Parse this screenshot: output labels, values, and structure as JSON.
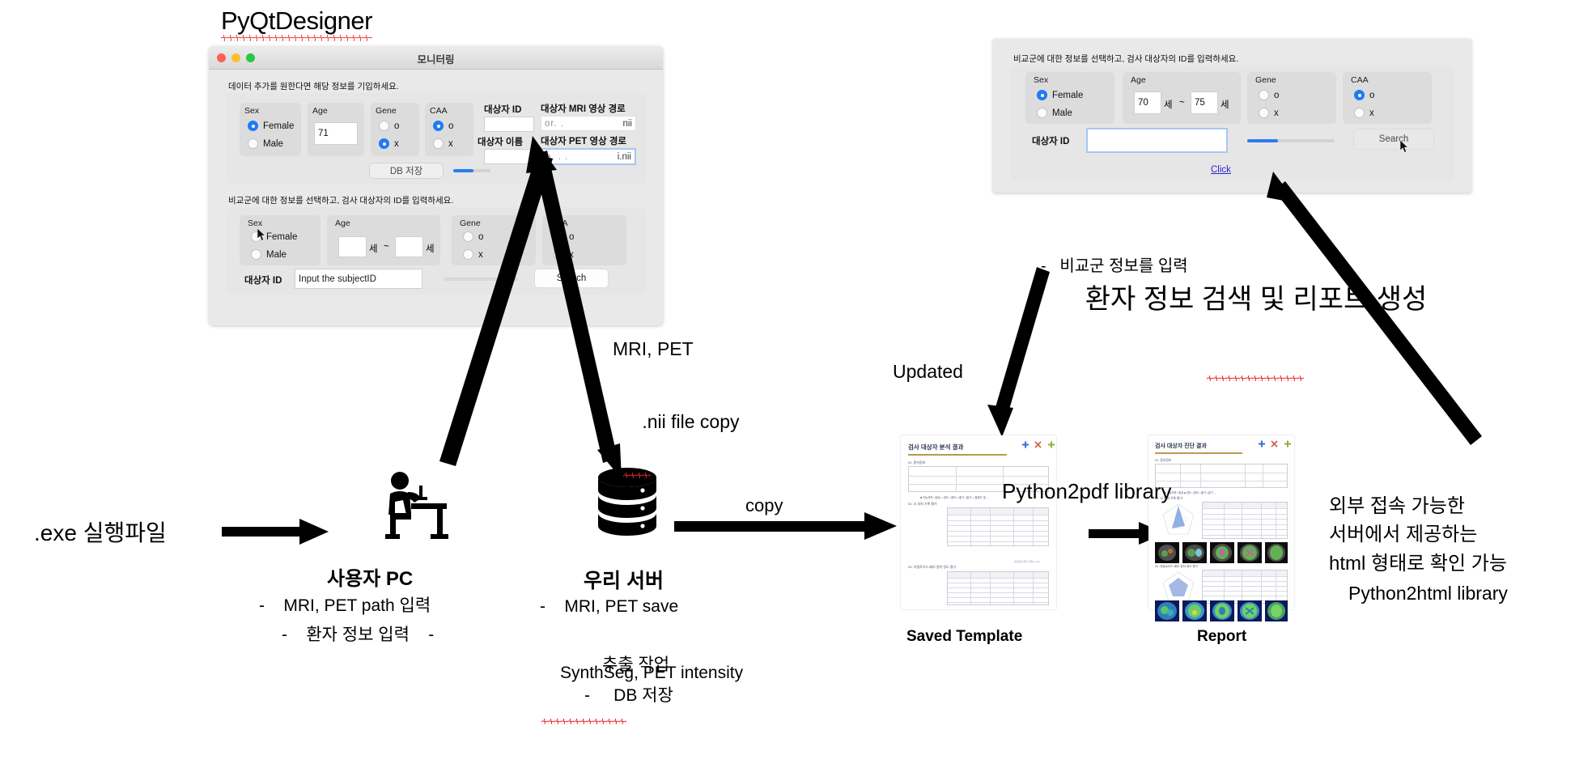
{
  "headings": {
    "pyqt_designer": "PyQtDesigner",
    "right_title": "환자 정보 검색 및 리포트 생성",
    "right_bullet": "-   비교군 정보를 입력"
  },
  "window_monitoring": {
    "title": "모니터링",
    "traffic_lights": [
      "close-red",
      "minimize-yellow",
      "maximize-green"
    ],
    "section1": {
      "hint": "데이터 추가를 원한다면 해당 정보를 기입하세요.",
      "sex": {
        "label": "Sex",
        "options": [
          "Female",
          "Male"
        ],
        "selected": "Female"
      },
      "age": {
        "label": "Age",
        "value": "71"
      },
      "gene": {
        "label": "Gene",
        "options": [
          "o",
          "x"
        ],
        "selected": "x"
      },
      "caa": {
        "label": "CAA",
        "options": [
          "o",
          "x"
        ],
        "selected": "o"
      },
      "subject_id": {
        "label": "대상자 ID",
        "value": ""
      },
      "subject_name": {
        "label": "대상자 이름",
        "value": ""
      },
      "mri_path": {
        "label": "대상자 MRI 영상 경로",
        "value": "or.        .",
        "suffix": "nii"
      },
      "pet_path": {
        "label": "대상자 PET 영상 경로",
        "value": "e. .     .",
        "suffix": "i.nii"
      },
      "save_button": "DB 저장",
      "progress": 55
    },
    "section2": {
      "hint": "비교군에 대한 정보를 선택하고, 검사 대상자의 ID를 입력하세요.",
      "sex": {
        "label": "Sex",
        "options": [
          "Female",
          "Male"
        ],
        "selected": ""
      },
      "age": {
        "label": "Age",
        "from": "",
        "to": "",
        "unit": "세",
        "separator": "~"
      },
      "gene": {
        "label": "Gene",
        "options": [
          "o",
          "x"
        ],
        "selected": ""
      },
      "caa": {
        "label": "CAA",
        "options": [
          "o",
          "x"
        ],
        "selected": ""
      },
      "subject_id": {
        "label": "대상자 ID",
        "placeholder": "Input the subjectID"
      },
      "search_button": "Search",
      "progress": 0
    }
  },
  "window_search": {
    "hint": "비교군에 대한 정보를 선택하고, 검사 대상자의 ID를 입력하세요.",
    "sex": {
      "label": "Sex",
      "options": [
        "Female",
        "Male"
      ],
      "selected": "Female"
    },
    "age": {
      "label": "Age",
      "from": "70",
      "to": "75",
      "unit": "세",
      "separator": "~"
    },
    "gene": {
      "label": "Gene",
      "options": [
        "o",
        "x"
      ],
      "selected": ""
    },
    "caa": {
      "label": "CAA",
      "options": [
        "o",
        "x"
      ],
      "selected": "o"
    },
    "subject_id": {
      "label": "대상자 ID",
      "value": ""
    },
    "search_button": "Search",
    "progress": 35,
    "click_link": "Click"
  },
  "flow": {
    "exe_label": ".exe 실행파일",
    "user_pc": {
      "title": "사용자 PC",
      "lines": [
        "-    MRI, PET path 입력",
        "-    환자 정보 입력    -"
      ]
    },
    "server": {
      "title": "우리 서버",
      "lines": [
        "-    MRI, PET save",
        "SynthSeg, PET intensity",
        "추출 작업",
        "-     DB 저장"
      ]
    },
    "nii_copy": [
      "MRI, PET",
      ".nii file copy"
    ],
    "copy_label": "copy",
    "updated_label": "Updated",
    "python2pdf": "Python2pdf library",
    "saved_template_caption": "Saved Template",
    "report_caption": "Report",
    "external_note": {
      "lines": [
        "외부 접속 가능한",
        "서버에서 제공하는",
        "html 형태로 확인 가능"
      ],
      "library": "Python2html library"
    }
  },
  "saved_template_doc": {
    "title": "검사 대상자 분석 결과",
    "sections": [
      "01. 환자정보",
      "02. 뇌 부피 기록 평가",
      "03. 아밀로이드-베타 침착 정도 평가"
    ]
  },
  "report_doc": {
    "title": "검사 대상자 진단 결과",
    "sections": [
      "01. 환자정보",
      "02. 뇌 부피 기록 평가",
      "03. 아밀로이드-베타 침착 정도 평가"
    ]
  },
  "colors": {
    "accent_blue": "#1f7bf4",
    "link_blue": "#2b22d6",
    "window_bg": "#e9e9e9",
    "group_bg": "#e3e3e3",
    "spellcheck_red": "#e8262a",
    "doc_gold": "#b89b52"
  }
}
